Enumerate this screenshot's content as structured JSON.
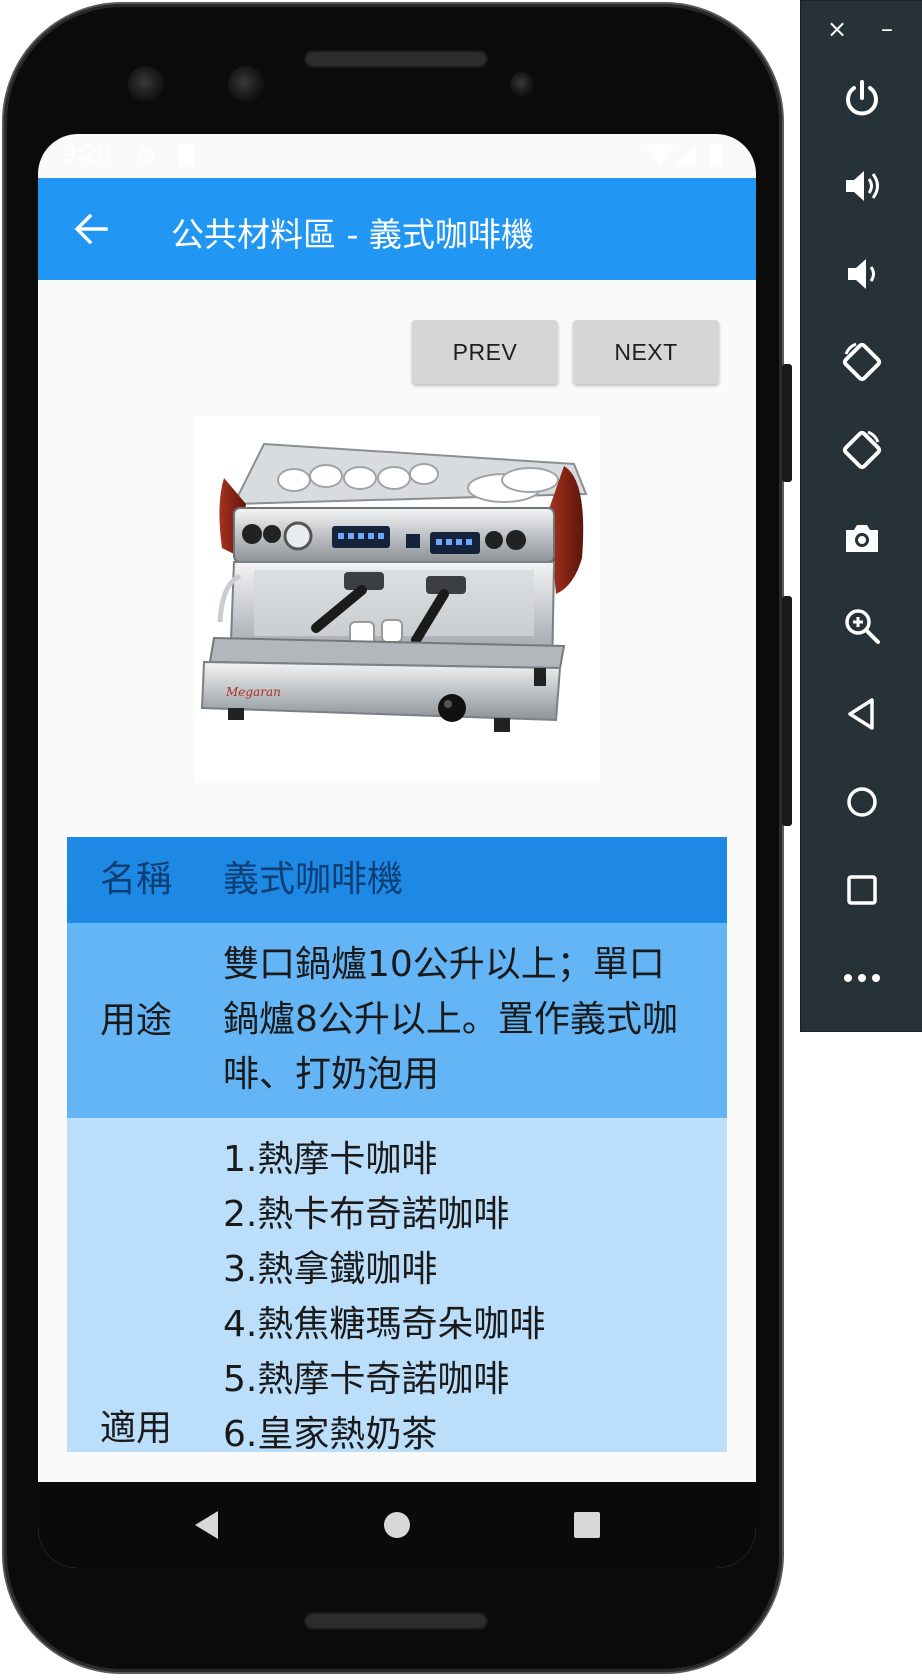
{
  "statusbar": {
    "time": "9:20"
  },
  "appbar": {
    "title": "公共材料區 - 義式咖啡機",
    "back_icon": "arrow-left-icon"
  },
  "buttons": {
    "prev": "PREV",
    "next": "NEXT"
  },
  "table": {
    "name": {
      "key": "名稱",
      "value": "義式咖啡機"
    },
    "use": {
      "key": "用途",
      "lines": [
        "雙口鍋爐10公升以上；單口",
        "鍋爐8公升以上。置作義式咖",
        "啡、打奶泡用"
      ]
    },
    "applicable": {
      "key": "適用",
      "items": [
        "1.熱摩卡咖啡",
        "2.熱卡布奇諾咖啡",
        "3.熱拿鐵咖啡",
        "4.熱焦糖瑪奇朵咖啡",
        "5.熱摩卡奇諾咖啡",
        "6.皇家熱奶茶"
      ]
    }
  },
  "colors": {
    "appbar": "#2196f3",
    "row_name": "#1e88e5",
    "row_use": "#64b5f6",
    "row_applicable": "#bbdefb",
    "button": "#d6d6d6",
    "emulator_panel": "#263238"
  },
  "emulator": {
    "window_controls": {
      "close": "×",
      "minimize": "–"
    },
    "icons": [
      "power-icon",
      "volume-up-icon",
      "volume-down-icon",
      "rotate-left-icon",
      "rotate-right-icon",
      "camera-icon",
      "zoom-icon",
      "back-icon",
      "home-icon",
      "overview-icon",
      "more-icon"
    ]
  }
}
